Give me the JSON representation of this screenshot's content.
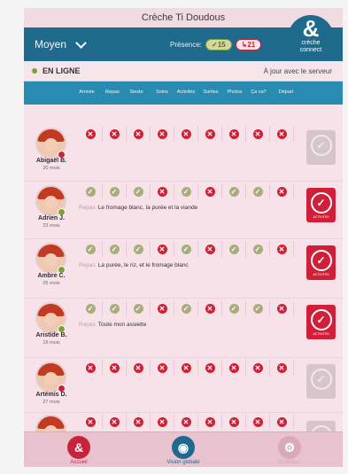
{
  "app": {
    "title": "Crèche Ti Doudous"
  },
  "header": {
    "group": "Moyen",
    "presence_label": "Présence:",
    "present_count": "✓15",
    "absent_count": "↳21",
    "logo": {
      "symbol": "&",
      "line1": "crèche",
      "line2": "connect"
    }
  },
  "status": {
    "online": "EN LIGNE",
    "sync": "À jour avec le serveur"
  },
  "columns": [
    "Arrivée",
    "Repas",
    "Sieste",
    "Soins",
    "Activités",
    "Sorties",
    "Photos",
    "Ça va?",
    "Départ"
  ],
  "children": [
    {
      "name": "Abigaël B.",
      "age": "20 mois",
      "statuses": [
        "no",
        "no",
        "no",
        "no",
        "no",
        "no",
        "no",
        "no",
        "no"
      ],
      "meal_label": "",
      "meal": "",
      "action": "grey",
      "action_label": ""
    },
    {
      "name": "Adrien J.",
      "age": "23 mois",
      "statuses": [
        "ok",
        "ok",
        "ok",
        "no",
        "ok",
        "no",
        "ok",
        "ok",
        "no"
      ],
      "meal_label": "Repas",
      "meal": "Le fromage blanc, la purée et la viande",
      "action": "red",
      "action_label": "ACTIVITES"
    },
    {
      "name": "Ambre C.",
      "age": "25 mois",
      "statuses": [
        "ok",
        "ok",
        "ok",
        "no",
        "ok",
        "no",
        "ok",
        "ok",
        "no"
      ],
      "meal_label": "Repas",
      "meal": "La purée, le riz, et le fromage blanc",
      "action": "red",
      "action_label": "ACTIVITES"
    },
    {
      "name": "Aristide B.",
      "age": "19 mois",
      "statuses": [
        "ok",
        "ok",
        "ok",
        "no",
        "ok",
        "no",
        "ok",
        "ok",
        "no"
      ],
      "meal_label": "Repas",
      "meal": "Toute mon assiette",
      "action": "red",
      "action_label": "ACTIVITES"
    },
    {
      "name": "Artémis D.",
      "age": "27 mois",
      "statuses": [
        "no",
        "no",
        "no",
        "no",
        "no",
        "no",
        "no",
        "no",
        "no"
      ],
      "meal_label": "",
      "meal": "",
      "action": "grey",
      "action_label": ""
    },
    {
      "name": "",
      "age": "",
      "statuses": [
        "no",
        "no",
        "no",
        "no",
        "no",
        "no",
        "no",
        "no",
        "no"
      ],
      "meal_label": "",
      "meal": "",
      "action": "grey",
      "action_label": ""
    }
  ],
  "nav": [
    {
      "label": "Accueil",
      "icon": "ampersand-icon",
      "glyph": "&",
      "color": "#c7243c"
    },
    {
      "label": "Vision globale",
      "icon": "eye-icon",
      "glyph": "◉",
      "color": "#1f6a8c"
    },
    {
      "label": "Réglages",
      "icon": "gear-icon",
      "glyph": "⚙",
      "color": "#d8a9b8"
    }
  ],
  "colors": {
    "accent_blue": "#1f6a8c",
    "header_blue": "#2a8bb0",
    "red": "#d01f38",
    "check_olive": "#a8ad7c"
  }
}
